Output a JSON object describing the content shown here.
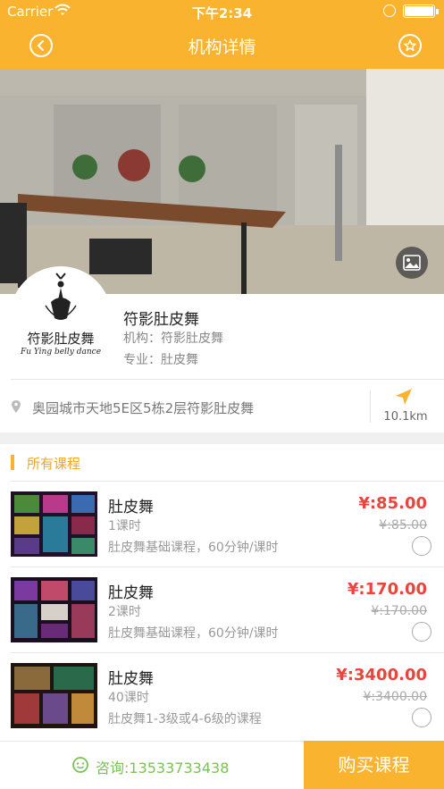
{
  "status_bar": {
    "carrier": "Carrier",
    "time": "下午2:34"
  },
  "nav": {
    "title": "机构详情"
  },
  "org": {
    "logo_cn": "符影肚皮舞",
    "logo_en": "Fu Ying belly dance",
    "name": "符影肚皮舞",
    "institution": "机构：符影肚皮舞",
    "specialty": "专业：肚皮舞",
    "address": "奥园城市天地5E区5栋2层符影肚皮舞",
    "distance": "10.1km"
  },
  "courses_section": {
    "title": "所有课程",
    "items": [
      {
        "name": "肚皮舞",
        "hours": "1课时",
        "description": "肚皮舞基础课程，60分钟/课时",
        "price": "¥:85.00",
        "original_price": "¥:85.00"
      },
      {
        "name": "肚皮舞",
        "hours": "2课时",
        "description": "肚皮舞基础课程，60分钟/课时",
        "price": "¥:170.00",
        "original_price": "¥:170.00"
      },
      {
        "name": "肚皮舞",
        "hours": "40课时",
        "description": "肚皮舞1-3级或4-6级的课程",
        "price": "¥:3400.00",
        "original_price": "¥:3400.00"
      }
    ]
  },
  "bottom": {
    "consult": "咨询:13533733438",
    "buy_label": "购买课程"
  },
  "colors": {
    "accent": "#f9b32f",
    "price": "#e8453c",
    "consult": "#7cc05a"
  },
  "icons": [
    "wifi-icon",
    "lock-rotation-icon",
    "battery-icon",
    "back-icon",
    "star-icon",
    "gallery-icon",
    "location-pin-icon",
    "navigation-arrow-icon",
    "chat-icon",
    "radio-icon"
  ]
}
